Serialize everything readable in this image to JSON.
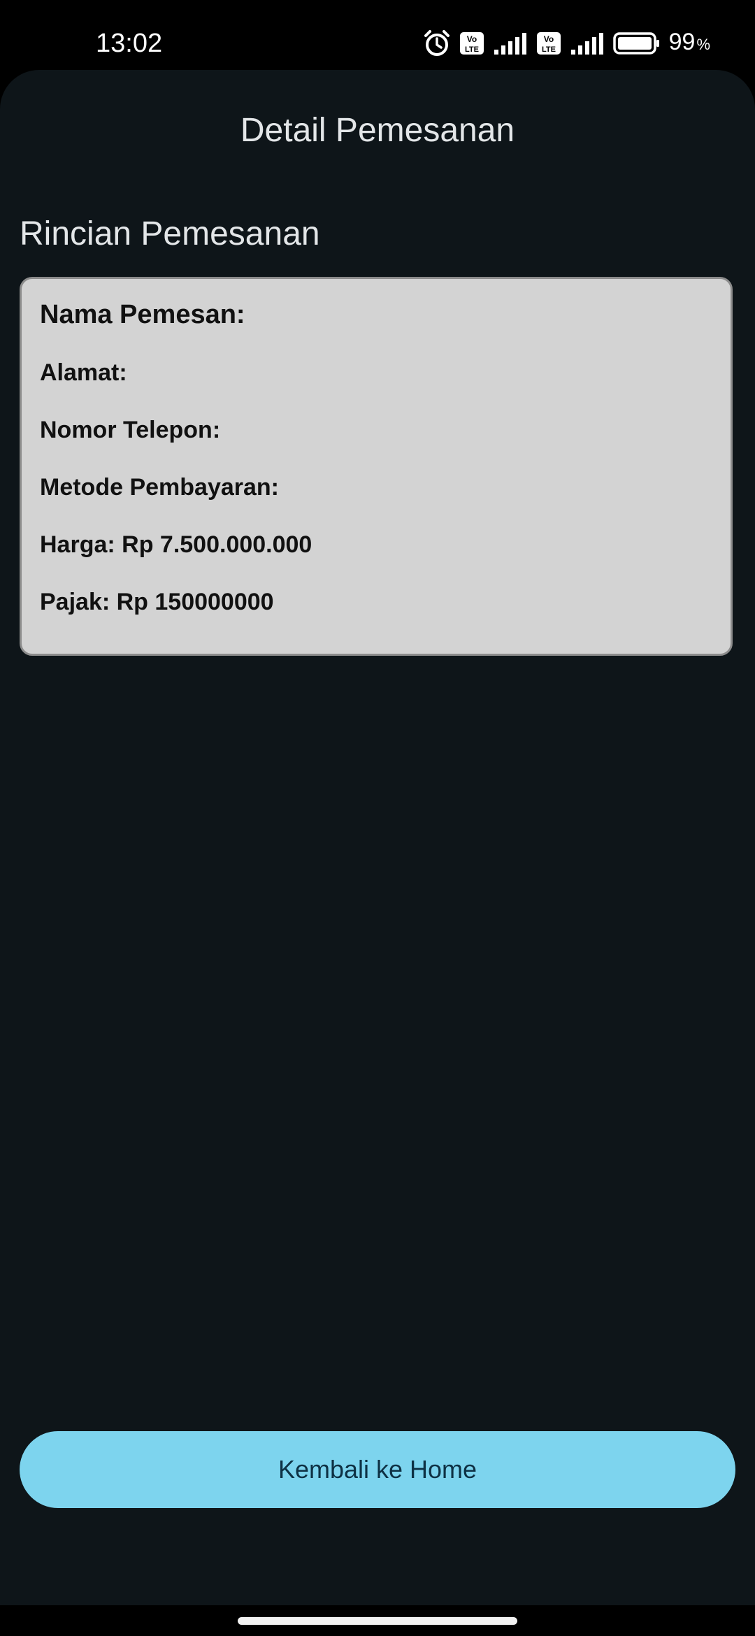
{
  "status_bar": {
    "time": "13:02",
    "battery_percent": "99",
    "battery_percent_sign": "%",
    "volte_label_top": "Vo",
    "volte_label_bottom": "LTE",
    "icons": [
      "alarm-icon",
      "volte-icon",
      "signal-icon",
      "volte-icon",
      "signal-icon",
      "battery-icon"
    ]
  },
  "header": {
    "title": "Detail Pemesanan"
  },
  "section": {
    "title": "Rincian Pemesanan"
  },
  "details": {
    "name_line": "Nama Pemesan: ",
    "address_line": "Alamat: ",
    "phone_line": "Nomor Telepon: ",
    "payment_method_line": "Metode Pembayaran: ",
    "price_line": "Harga: Rp 7.500.000.000",
    "tax_line": "Pajak: Rp 150000000"
  },
  "actions": {
    "back_home_label": "Kembali ke Home"
  },
  "colors": {
    "background": "#0e1519",
    "card": "#d3d3d3",
    "button": "#7dd4ee",
    "button_text": "#0e3144"
  }
}
